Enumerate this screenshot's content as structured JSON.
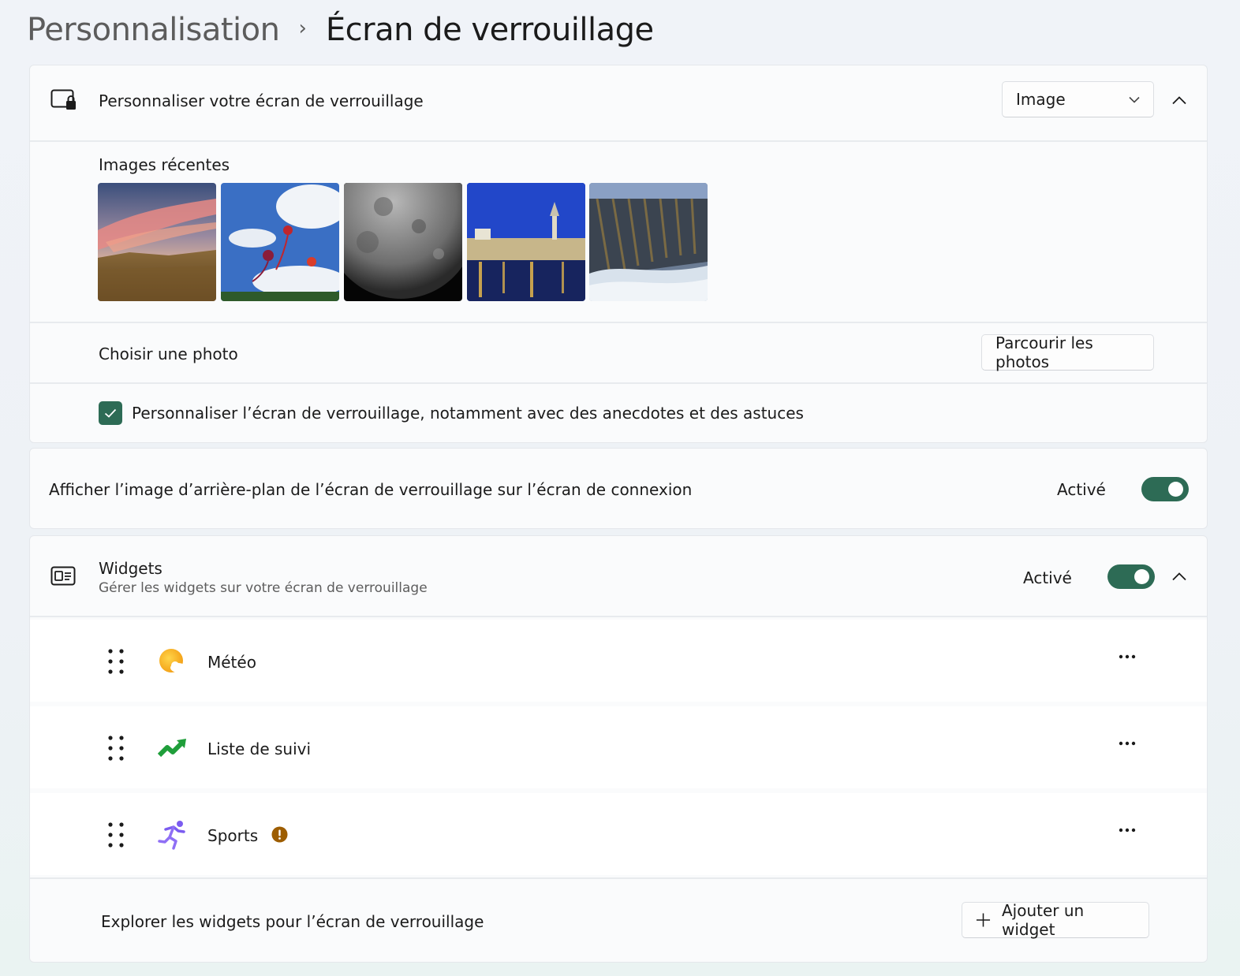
{
  "breadcrumb": {
    "parent": "Personnalisation",
    "separator": "›",
    "current": "Écran de verrouillage"
  },
  "lockscreen": {
    "label": "Personnaliser votre écran de verrouillage",
    "dropdown_value": "Image",
    "recent_images_label": "Images récentes",
    "recent_images": [
      "sunset-prairie",
      "kites-sky",
      "moon",
      "city-night-reflection",
      "basalt-wave"
    ],
    "choose_photo_label": "Choisir une photo",
    "browse_button": "Parcourir les photos",
    "tips_checkbox_label": "Personnaliser l’écran de verrouillage, notamment avec des anecdotes et des astuces",
    "tips_checked": true
  },
  "signin_background": {
    "label": "Afficher l’image d’arrière-plan de l’écran de verrouillage sur l’écran de connexion",
    "state_label": "Activé",
    "enabled": true
  },
  "widgets": {
    "title": "Widgets",
    "subtitle": "Gérer les widgets sur votre écran de verrouillage",
    "state_label": "Activé",
    "enabled": true,
    "items": [
      {
        "label": "Météo",
        "icon": "weather-icon"
      },
      {
        "label": "Liste de suivi",
        "icon": "stock-trend-icon"
      },
      {
        "label": "Sports",
        "icon": "runner-icon",
        "warning": true
      }
    ],
    "explore_label": "Explorer les widgets pour l’écran de verrouillage",
    "add_button": "Ajouter un widget"
  },
  "colors": {
    "accent": "#2d6b55",
    "warning": "#9d5d00"
  }
}
